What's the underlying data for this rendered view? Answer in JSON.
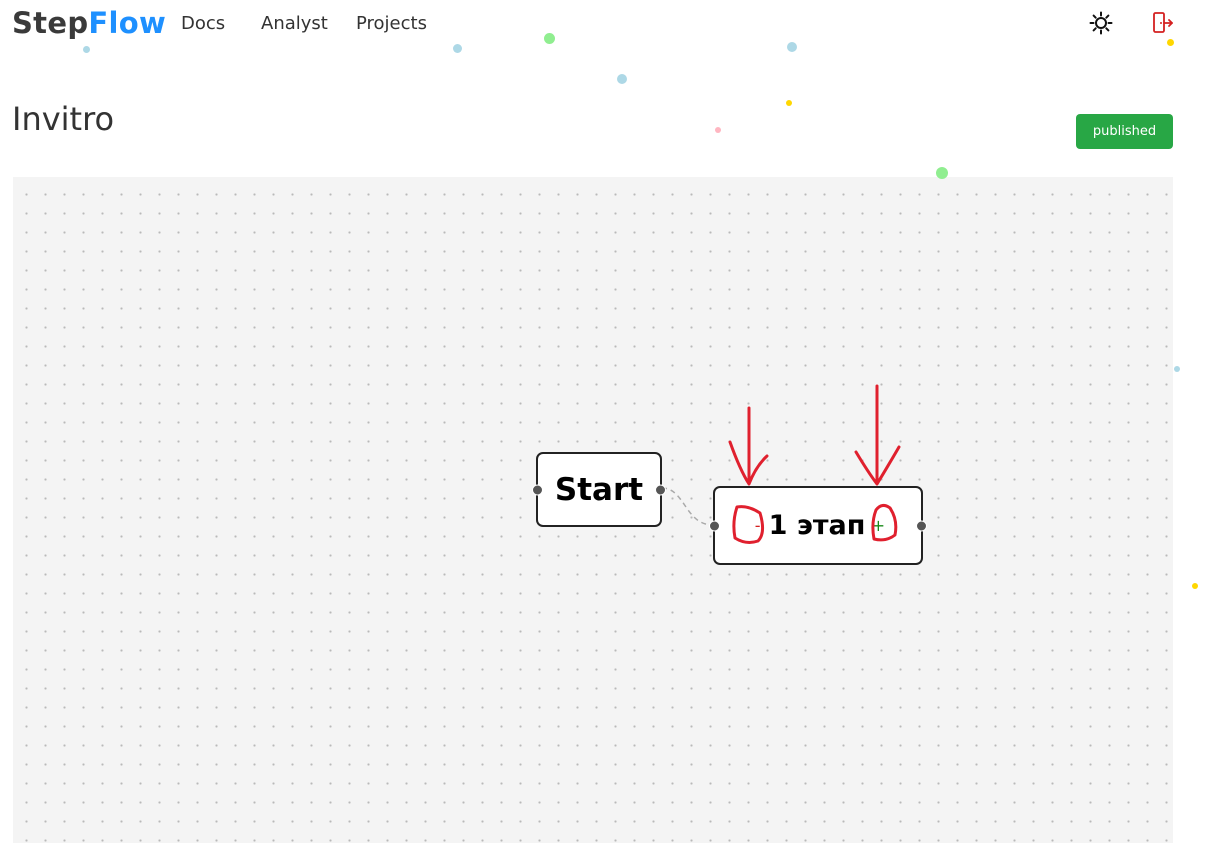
{
  "header": {
    "logo_part1": "Step",
    "logo_part2": "Flow",
    "nav": [
      {
        "label": "Docs"
      },
      {
        "label": "Analyst"
      },
      {
        "label": "Projects"
      }
    ],
    "theme_icon": "sun-icon",
    "logout_icon": "logout-door-icon"
  },
  "project": {
    "title": "Invitro",
    "status": "published"
  },
  "flow": {
    "start_node": "Start",
    "stage_node": "1 этап",
    "stage_minus": "-",
    "stage_plus": "+"
  },
  "colors": {
    "accent": "#1e90ff",
    "status": "#28a745",
    "annotation": "#e0202e"
  }
}
